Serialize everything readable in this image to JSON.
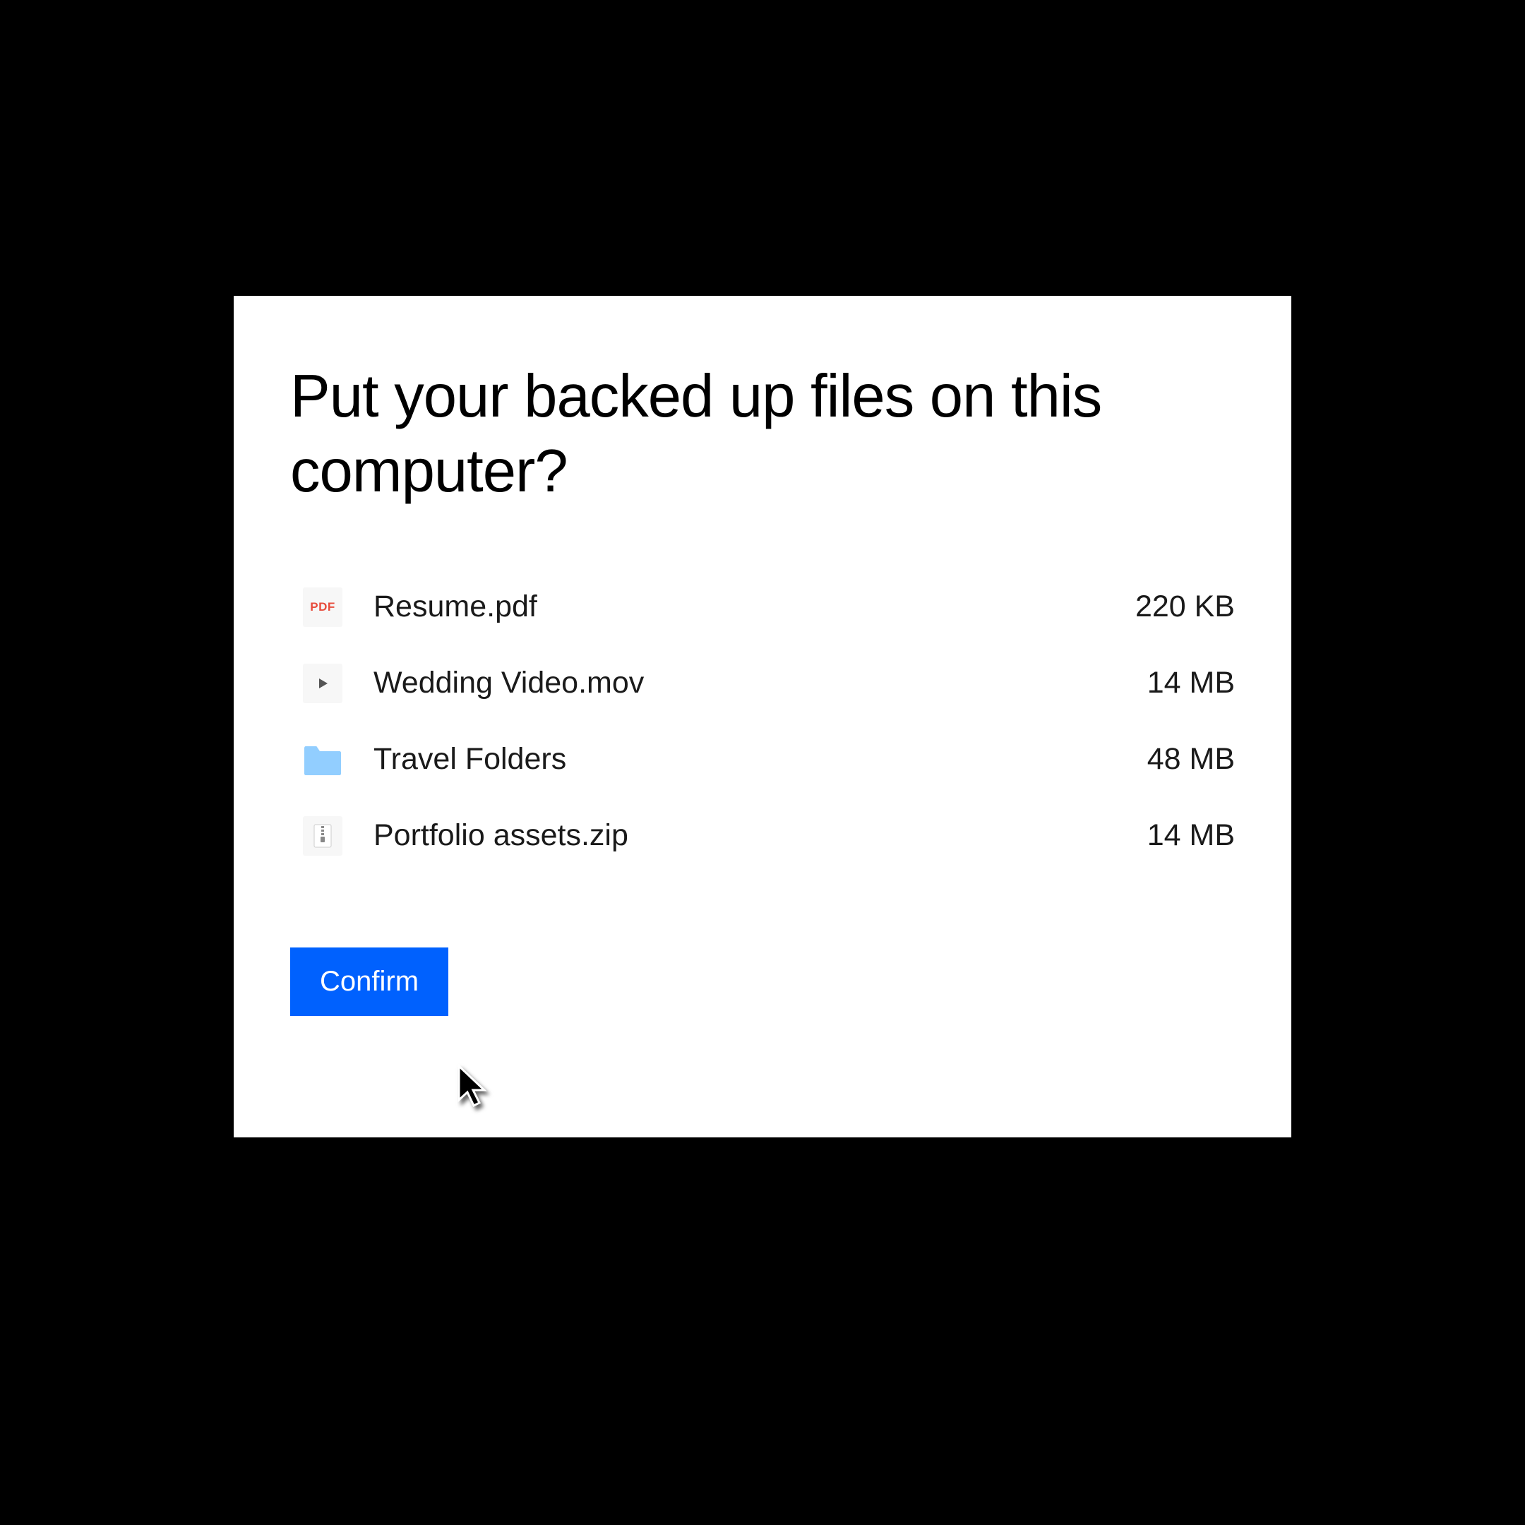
{
  "dialog": {
    "title": "Put your backed up files on this computer?",
    "confirm_label": "Confirm"
  },
  "files": [
    {
      "name": "Resume.pdf",
      "size": "220 KB",
      "icon": "pdf"
    },
    {
      "name": "Wedding Video.mov",
      "size": "14 MB",
      "icon": "video"
    },
    {
      "name": "Travel Folders",
      "size": "48 MB",
      "icon": "folder"
    },
    {
      "name": "Portfolio assets.zip",
      "size": "14 MB",
      "icon": "zip"
    }
  ]
}
